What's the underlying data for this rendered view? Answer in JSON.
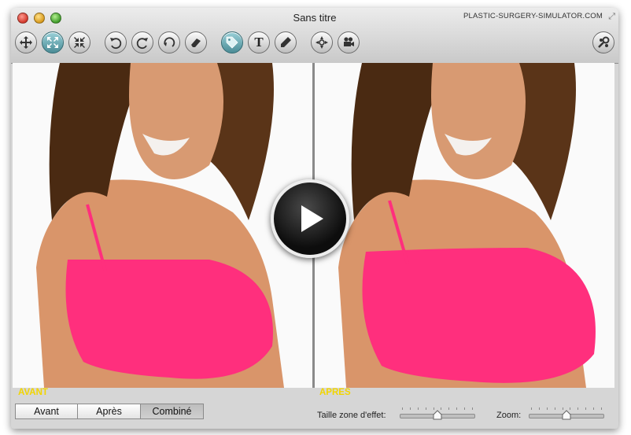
{
  "window": {
    "title": "Sans titre",
    "brand": "PLASTIC-SURGERY-SIMULATOR.COM"
  },
  "toolbar": {
    "buttons": [
      {
        "icon": "move-icon",
        "active": false
      },
      {
        "icon": "expand-icon",
        "active": true
      },
      {
        "icon": "contract-icon",
        "active": false
      },
      {
        "icon": "undo-icon",
        "active": false
      },
      {
        "icon": "redo-icon",
        "active": false
      },
      {
        "icon": "reset-icon",
        "active": false
      },
      {
        "icon": "eraser-icon",
        "active": false
      },
      {
        "icon": "tag-icon",
        "active": true
      },
      {
        "icon": "text-icon",
        "active": false
      },
      {
        "icon": "pencil-icon",
        "active": false
      },
      {
        "icon": "navigate-icon",
        "active": false
      },
      {
        "icon": "video-camera-icon",
        "active": false
      },
      {
        "icon": "settings-icon",
        "active": false
      }
    ],
    "text_glyph": "T"
  },
  "panels": {
    "before_label": "AVANT",
    "after_label": "APRES"
  },
  "view_modes": {
    "options": [
      "Avant",
      "Après",
      "Combiné"
    ],
    "selected": "Combiné"
  },
  "effect_size": {
    "label": "Taille zone d'effet:",
    "level": 0.5
  },
  "zoom": {
    "label": "Zoom:",
    "level": 0.5
  },
  "colors": {
    "caption": "#f2d500",
    "top_pink": "#ff2f7d",
    "skin": "#d9956a",
    "hair": "#5a3418"
  }
}
